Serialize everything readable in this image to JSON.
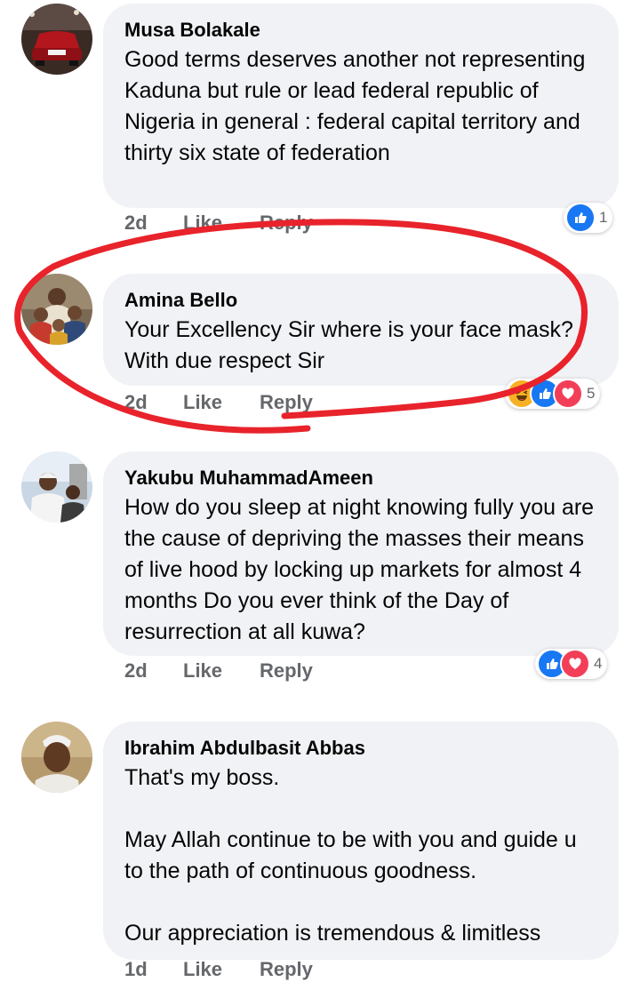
{
  "comments": [
    {
      "author": "Musa Bolakale",
      "text": "Good terms deserves another not representing Kaduna but rule or lead federal republic of Nigeria in general : federal capital territory and thirty six state of federation",
      "time": "2d",
      "like_label": "Like",
      "reply_label": "Reply",
      "reactions": [
        "like-icon"
      ],
      "reaction_count": "1"
    },
    {
      "author": "Amina Bello",
      "text": "Your Excellency Sir where is your face mask? With due respect Sir",
      "time": "2d",
      "like_label": "Like",
      "reply_label": "Reply",
      "reactions": [
        "haha-icon",
        "like-icon",
        "love-icon"
      ],
      "reaction_count": "5"
    },
    {
      "author": "Yakubu MuhammadAmeen",
      "text": "How do you sleep at night knowing fully you are the cause of depriving the masses their means of live hood by locking up markets for almost 4 months Do you ever think of the Day of resurrection at all kuwa?",
      "time": "2d",
      "like_label": "Like",
      "reply_label": "Reply",
      "reactions": [
        "like-icon",
        "love-icon"
      ],
      "reaction_count": "4"
    },
    {
      "author": "Ibrahim Abdulbasit Abbas",
      "text": "That's my boss.\n\nMay Allah continue to be with you and guide u to the path of continuous goodness.\n\nOur appreciation is tremendous  & limitless",
      "time": "1d",
      "like_label": "Like",
      "reply_label": "Reply"
    }
  ],
  "colors": {
    "bubble": "#f0f2f5",
    "action_text": "#65676b",
    "like_blue": "#1877f2",
    "love_red": "#f33e58",
    "highlight_red": "#e8232b"
  }
}
